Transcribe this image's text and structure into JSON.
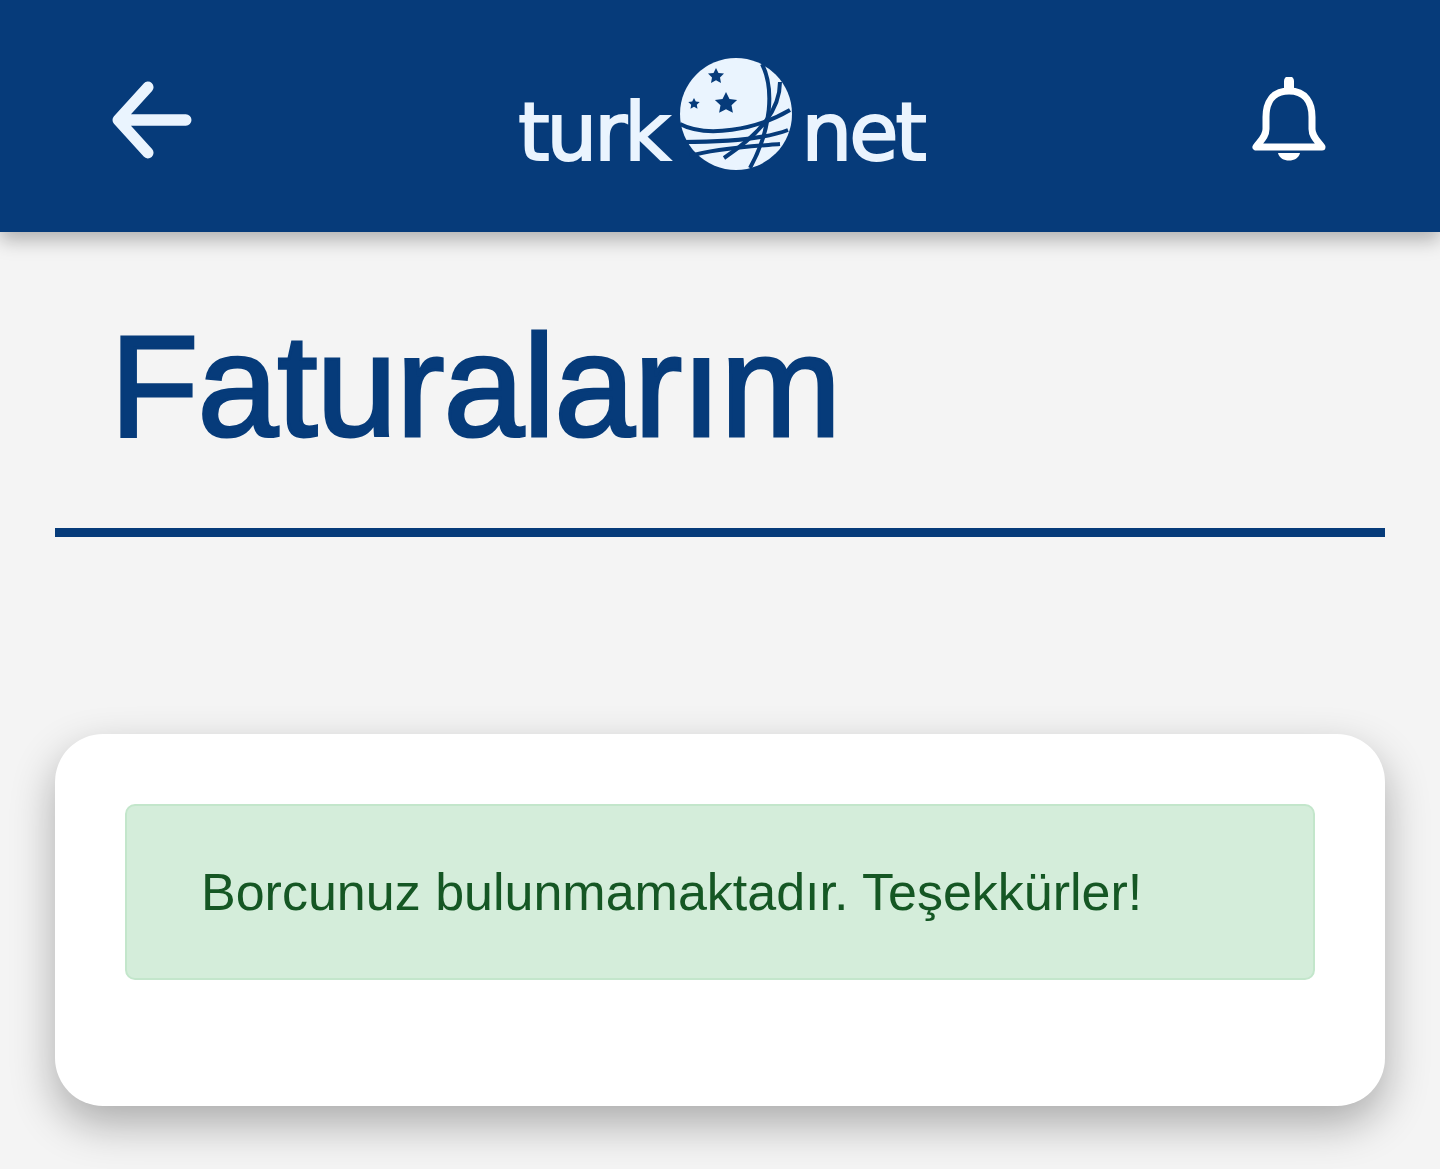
{
  "header": {
    "logo": {
      "left": "turk",
      "right": "net"
    }
  },
  "page": {
    "title": "Faturalarım"
  },
  "notice": {
    "kind": "success",
    "message": "Borcunuz bulunmamaktadır. Teşekkürler!"
  }
}
